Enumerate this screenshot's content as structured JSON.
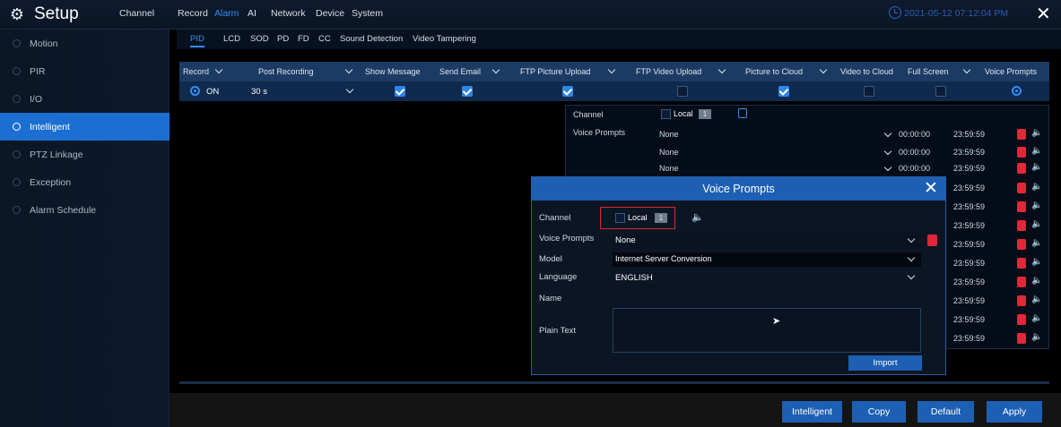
{
  "header": {
    "title": "Setup",
    "nav": [
      "Channel",
      "Record",
      "Alarm",
      "AI",
      "Network",
      "Device",
      "System"
    ],
    "active_nav": "Alarm",
    "datetime": "2021-05-12 07:12:04 PM"
  },
  "sidebar": {
    "items": [
      {
        "label": "Motion"
      },
      {
        "label": "PIR"
      },
      {
        "label": "I/O"
      },
      {
        "label": "Intelligent"
      },
      {
        "label": "PTZ Linkage"
      },
      {
        "label": "Exception"
      },
      {
        "label": "Alarm Schedule"
      }
    ],
    "active_index": 3
  },
  "subtabs": [
    "PID",
    "LCD",
    "SOD",
    "PD",
    "FD",
    "CC",
    "Sound Detection",
    "Video Tampering"
  ],
  "table": {
    "headers": [
      "Record",
      "Post Recording",
      "Show Message",
      "Send Email",
      "FTP Picture Upload",
      "FTP Video Upload",
      "Picture to Cloud",
      "Video to Cloud",
      "Full Screen",
      "Voice Prompts"
    ],
    "row": {
      "record": "ON",
      "post_recording": "30 s",
      "show_message": true,
      "send_email": true,
      "ftp_picture_upload": true,
      "ftp_video_upload": false,
      "picture_to_cloud": true,
      "video_to_cloud": false,
      "full_screen": false,
      "voice_prompts": true
    }
  },
  "voice_panel": {
    "channel_label": "Channel",
    "local_label": "Local",
    "local_badge": "1",
    "voice_prompts_label": "Voice Prompts",
    "rows": [
      {
        "prompt": "None",
        "start": "00:00:00",
        "end": "23:59:59"
      },
      {
        "prompt": "None",
        "start": "00:00:00",
        "end": "23:59:59"
      },
      {
        "prompt": "None",
        "start": "00:00:00",
        "end": "23:59:59"
      },
      {
        "end": "23:59:59"
      },
      {
        "end": "23:59:59"
      },
      {
        "end": "23:59:59"
      },
      {
        "end": "23:59:59"
      },
      {
        "end": "23:59:59"
      },
      {
        "end": "23:59:59"
      },
      {
        "end": "23:59:59"
      },
      {
        "end": "23:59:59"
      },
      {
        "end": "23:59:59"
      }
    ]
  },
  "modal": {
    "title": "Voice Prompts",
    "channel_label": "Channel",
    "local_label": "Local",
    "local_badge": "1",
    "voice_prompts_label": "Voice Prompts",
    "voice_prompts_value": "None",
    "model_label": "Model",
    "model_value": "Internet Server Conversion",
    "language_label": "Language",
    "language_value": "ENGLISH",
    "name_label": "Name",
    "plain_text_label": "Plain Text",
    "import_label": "Import"
  },
  "footer": {
    "buttons": [
      "Intelligent",
      "Copy",
      "Default",
      "Apply"
    ]
  },
  "colors": {
    "accent": "#1d5fb2",
    "active_tab": "#2e8ef7",
    "delete": "#e0283a"
  }
}
